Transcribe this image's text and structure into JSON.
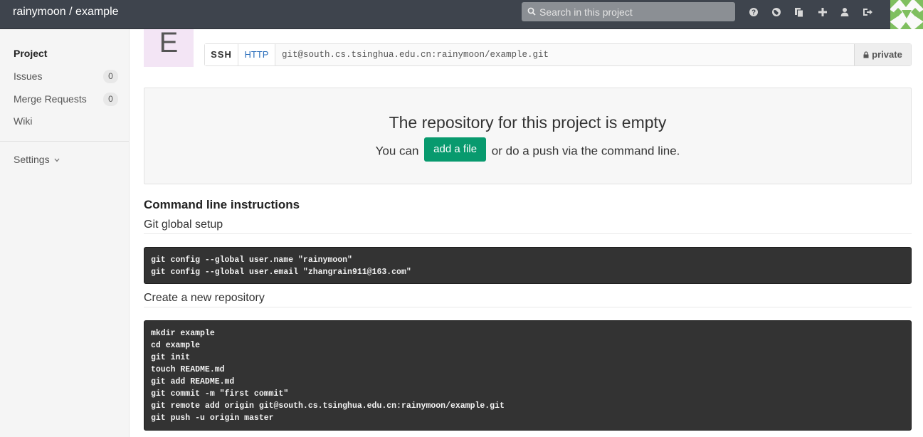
{
  "header": {
    "title": "rainymoon / example",
    "search_placeholder": "Search in this project",
    "icons": [
      "help-icon",
      "globe-icon",
      "copy-icon",
      "plus-icon",
      "user-icon",
      "sign-out-icon"
    ]
  },
  "sidebar": {
    "items": [
      {
        "label": "Project",
        "active": true
      },
      {
        "label": "Issues",
        "count": "0"
      },
      {
        "label": "Merge Requests",
        "count": "0"
      },
      {
        "label": "Wiki"
      }
    ],
    "settings_label": "Settings"
  },
  "project": {
    "avatar_letter": "E",
    "clone": {
      "ssh_label": "SSH",
      "http_label": "HTTP",
      "url": "git@south.cs.tsinghua.edu.cn:rainymoon/example.git",
      "visibility_label": "private"
    }
  },
  "empty": {
    "title": "The repository for this project is empty",
    "prefix": "You can",
    "button_label": "add a file",
    "suffix": "or do a push via the command line."
  },
  "instructions": {
    "heading": "Command line instructions",
    "global_setup_title": "Git global setup",
    "global_setup_lines": [
      "git config --global user.name \"rainymoon\"",
      "git config --global user.email \"zhangrain911@163.com\""
    ],
    "new_repo_title": "Create a new repository",
    "new_repo_lines": [
      "mkdir example",
      "cd example",
      "git init",
      "touch README.md",
      "git add README.md",
      "git commit -m \"first commit\"",
      "git remote add origin git@south.cs.tsinghua.edu.cn:rainymoon/example.git",
      "git push -u origin master"
    ]
  },
  "colors": {
    "header_bg": "#3e444d",
    "accent_green": "#089a6e",
    "code_bg": "#333333"
  }
}
